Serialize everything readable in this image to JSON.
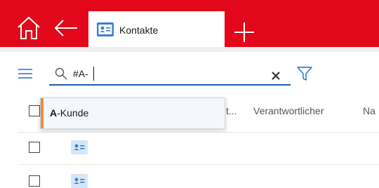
{
  "colors": {
    "brand_red": "#e2071b",
    "search_underline": "#1f5fa8",
    "suggestion_accent": "#f08c3c",
    "contact_icon_blue": "#3b7fd0"
  },
  "icons": {
    "home": "home-icon",
    "back": "arrow-left-icon",
    "tab": "contact-card-icon",
    "new_tab": "plus-icon",
    "menu": "hamburger-menu-icon",
    "search": "search-icon",
    "clear": "close-icon",
    "filter": "filter-icon"
  },
  "tab": {
    "label": "Kontakte"
  },
  "search": {
    "value": "#A-"
  },
  "suggestions": [
    {
      "bold": "A",
      "rest": "-Kunde"
    }
  ],
  "columns": {
    "truncated": "t...",
    "owner": "Verantwortlicher",
    "next": "Na"
  },
  "rows": [
    {
      "icon": "contact-card-icon"
    },
    {
      "icon": "contact-card-icon"
    }
  ]
}
